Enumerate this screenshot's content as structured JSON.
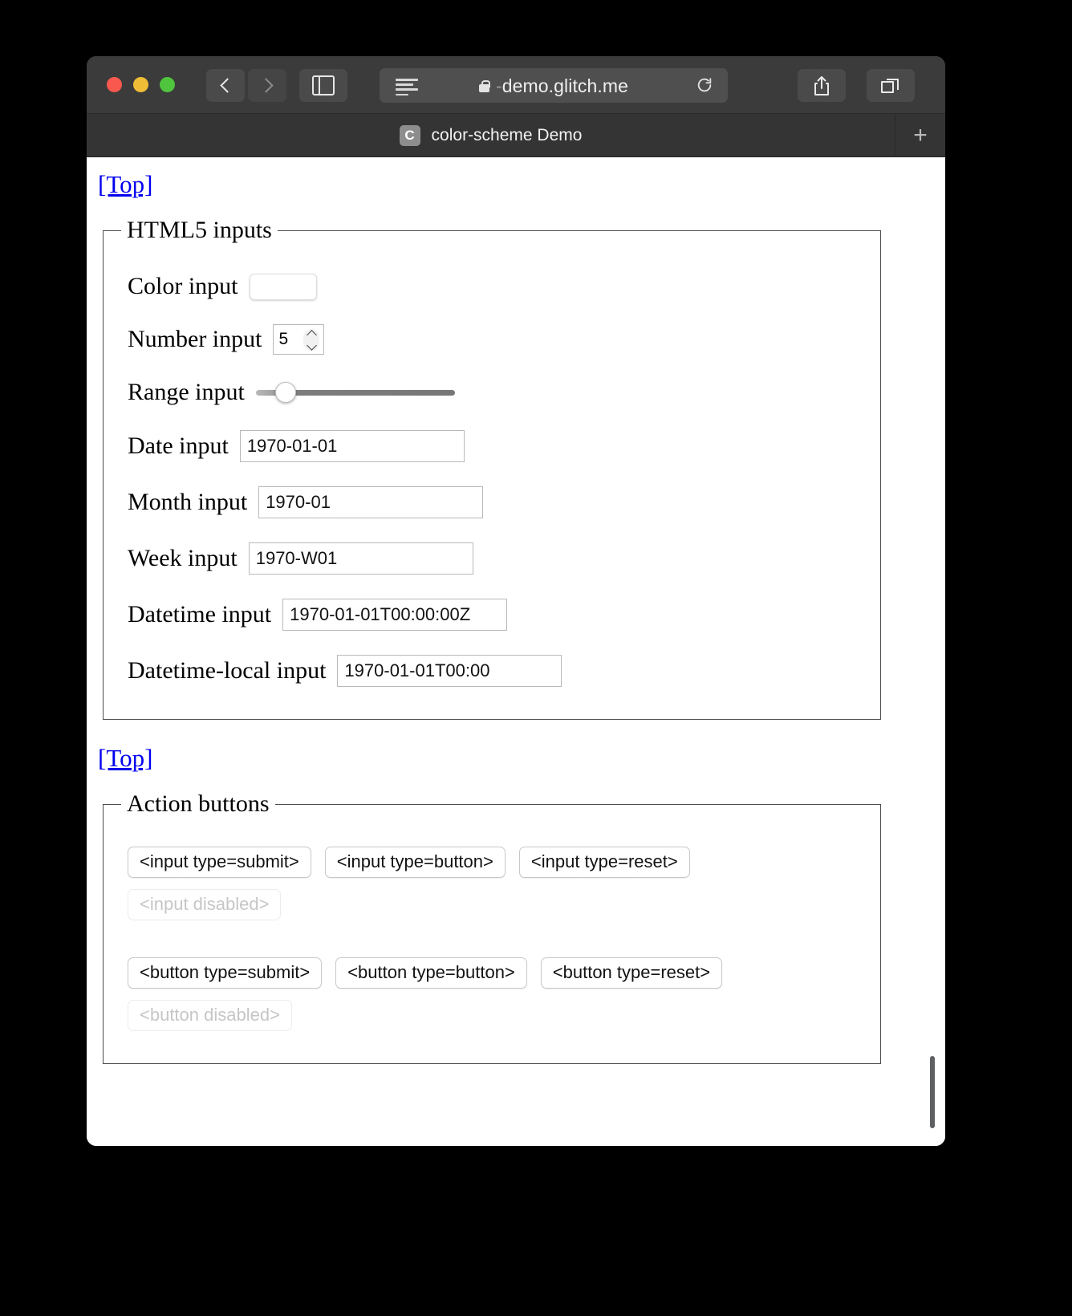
{
  "browser": {
    "window_controls": [
      "close",
      "minimize",
      "maximize"
    ],
    "back_label": "Back",
    "forward_label": "Forward",
    "sidebar_label": "Show sidebar",
    "reader_label": "Reader view",
    "url_prefix": "-",
    "url": "demo.glitch.me",
    "reload_label": "Reload",
    "share_label": "Share",
    "tab_overview_label": "Tab overview",
    "new_tab_label": "+",
    "tab": {
      "favicon_letter": "C",
      "title": "color-scheme Demo"
    }
  },
  "page": {
    "top_link_1": "[Top]",
    "top_link_2": "[Top]",
    "inputs_section": {
      "legend": "HTML5 inputs",
      "rows": [
        {
          "label": "Color input",
          "type": "color",
          "value": "#000000"
        },
        {
          "label": "Number input",
          "type": "number",
          "value": "5"
        },
        {
          "label": "Range input",
          "type": "range",
          "value": "12"
        },
        {
          "label": "Date input",
          "type": "date",
          "value": "1970-01-01"
        },
        {
          "label": "Month input",
          "type": "month",
          "value": "1970-01"
        },
        {
          "label": "Week input",
          "type": "week",
          "value": "1970-W01"
        },
        {
          "label": "Datetime input",
          "type": "text",
          "value": "1970-01-01T00:00:00Z"
        },
        {
          "label": "Datetime-local input",
          "type": "datetime-local",
          "value": "1970-01-01T00:00"
        }
      ]
    },
    "actions_section": {
      "legend": "Action buttons",
      "input_buttons": [
        "<input type=submit>",
        "<input type=button>",
        "<input type=reset>"
      ],
      "input_disabled": "<input disabled>",
      "button_buttons": [
        "<button type=submit>",
        "<button type=button>",
        "<button type=reset>"
      ],
      "button_disabled": "<button disabled>"
    }
  },
  "colors": {
    "link": "#0000ee",
    "color_swatch": "#000000",
    "toolbar_bg": "#3b3b3b",
    "page_bg": "#ffffff"
  }
}
